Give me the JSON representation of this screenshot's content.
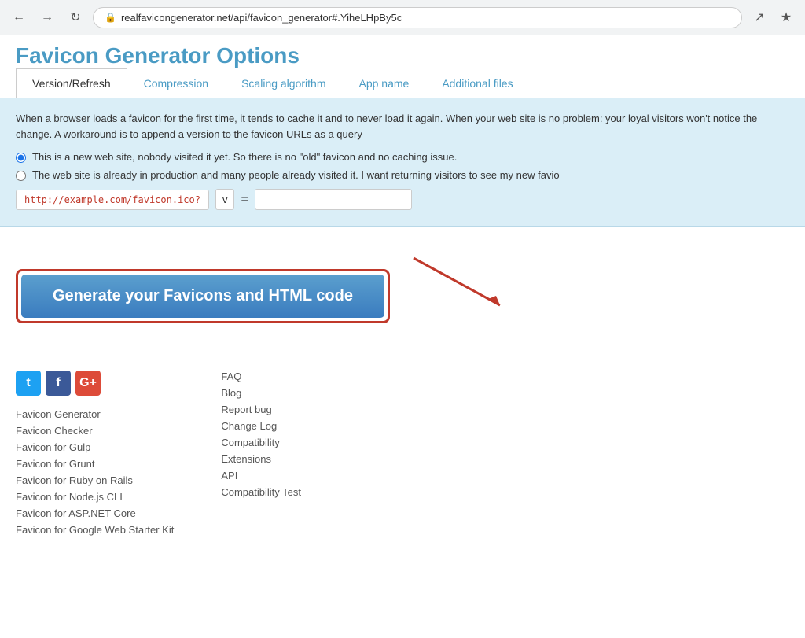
{
  "browser": {
    "url": "realfavicongenerator.net/api/favicon_generator#.YiheLHpBy5c",
    "back_title": "Back",
    "forward_title": "Forward",
    "refresh_title": "Refresh"
  },
  "page": {
    "title": "Favicon Generator Options"
  },
  "tabs": [
    {
      "id": "version-refresh",
      "label": "Version/Refresh",
      "active": true
    },
    {
      "id": "compression",
      "label": "Compression",
      "active": false
    },
    {
      "id": "scaling-algorithm",
      "label": "Scaling algorithm",
      "active": false
    },
    {
      "id": "app-name",
      "label": "App name",
      "active": false
    },
    {
      "id": "additional-files",
      "label": "Additional files",
      "active": false
    }
  ],
  "info": {
    "description": "When a browser loads a favicon for the first time, it tends to cache it and to never load it again. When your web site is no problem: your loyal visitors won't notice the change. A workaround is to append a version to the favicon URLs as a query"
  },
  "radio_options": [
    {
      "id": "new-site",
      "label": "This is a new web site, nobody visited it yet. So there is no \"old\" favicon and no caching issue.",
      "checked": true
    },
    {
      "id": "production-site",
      "label": "The web site is already in production and many people already visited it. I want returning visitors to see my new favio",
      "checked": false
    }
  ],
  "version_row": {
    "prefix": "http://example.com/favicon.ico?",
    "v_label": "v",
    "equals": "=",
    "input_value": ""
  },
  "generate_button": {
    "label": "Generate your Favicons and HTML code"
  },
  "footer": {
    "social": [
      {
        "name": "twitter",
        "label": "t"
      },
      {
        "name": "facebook",
        "label": "f"
      },
      {
        "name": "googleplus",
        "label": "G+"
      }
    ],
    "left_links": [
      "Favicon Generator",
      "Favicon Checker",
      "Favicon for Gulp",
      "Favicon for Grunt",
      "Favicon for Ruby on Rails",
      "Favicon for Node.js CLI",
      "Favicon for ASP.NET Core",
      "Favicon for Google Web Starter Kit"
    ],
    "right_links": [
      "FAQ",
      "Blog",
      "Report bug",
      "Change Log",
      "Compatibility",
      "Extensions",
      "API",
      "Compatibility Test"
    ]
  }
}
